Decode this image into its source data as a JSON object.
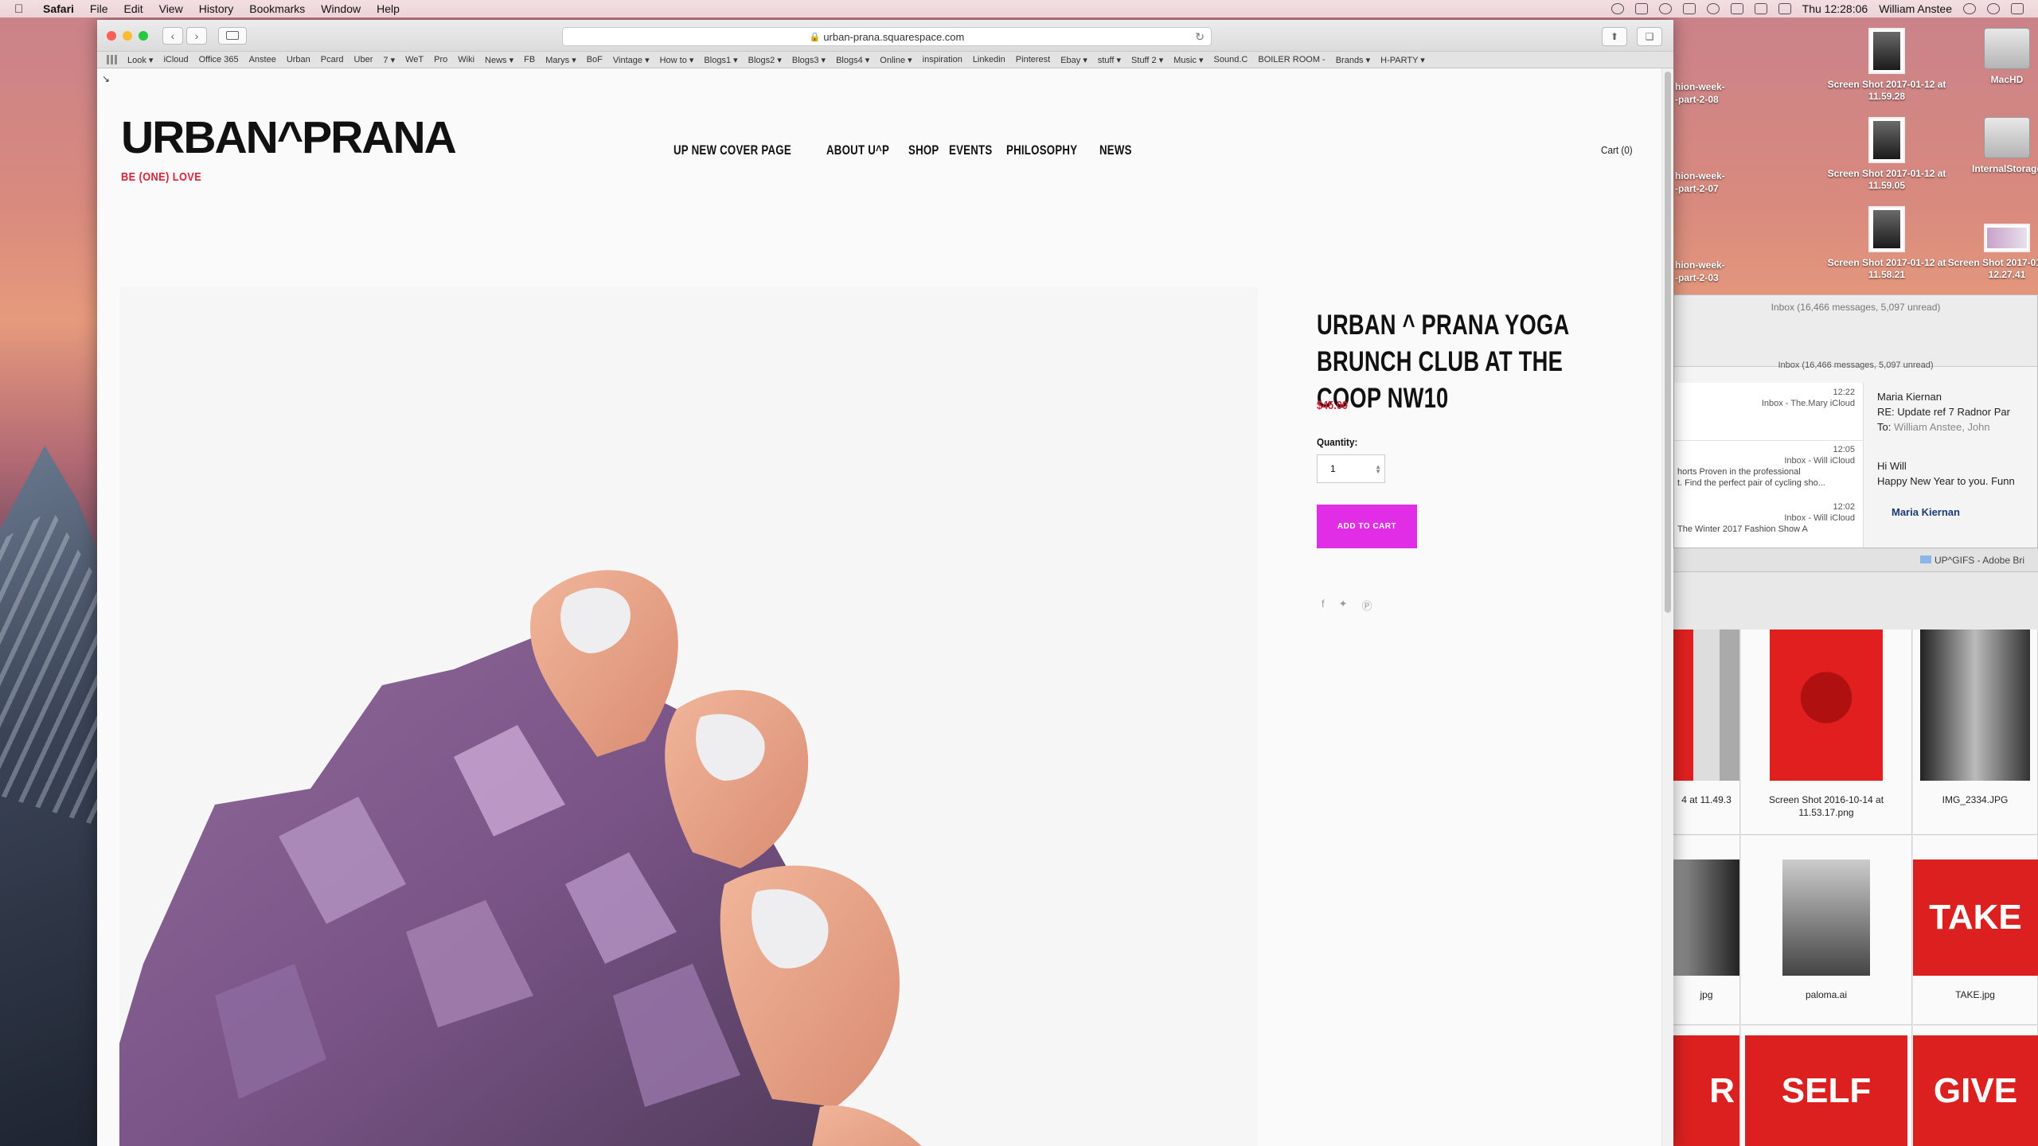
{
  "menubar": {
    "app_name": "Safari",
    "items": [
      "File",
      "Edit",
      "View",
      "History",
      "Bookmarks",
      "Window",
      "Help"
    ],
    "clock": "Thu 12:28:06",
    "user": "William Anstee"
  },
  "browser": {
    "url": "urban-prana.squarespace.com",
    "bookmarks": [
      "Look ▾",
      "iCloud",
      "Office 365",
      "Anstee",
      "Urban",
      "Pcard",
      "Uber",
      "7 ▾",
      "WeT",
      "Pro",
      "Wiki",
      "News ▾",
      "FB",
      "Marys ▾",
      "BoF",
      "Vintage ▾",
      "How to ▾",
      "Blogs1 ▾",
      "Blogs2 ▾",
      "Blogs3 ▾",
      "Blogs4 ▾",
      "Online ▾",
      "inspiration",
      "Linkedin",
      "Pinterest",
      "Ebay ▾",
      "stuff ▾",
      "Stuff 2 ▾",
      "Music ▾",
      "Sound.C",
      "BOILER ROOM -",
      "Brands ▾",
      "H-PARTY ▾"
    ]
  },
  "site": {
    "logo": "URBAN^PRANA",
    "tagline": "BE (ONE) LOVE",
    "nav": [
      "UP NEW COVER PAGE",
      "ABOUT U^P",
      "SHOP",
      "EVENTS",
      "PHILOSOPHY",
      "NEWS"
    ],
    "cart": "Cart (0)"
  },
  "product": {
    "title": "URBAN ^ PRANA YOGA BRUNCH CLUB AT THE COOP NW10",
    "price": "$45.00",
    "quantity_label": "Quantity:",
    "quantity_value": "1",
    "add_to_cart": "ADD TO CART",
    "accent": "#e12ee6",
    "price_color": "#e0213a"
  },
  "desktop": {
    "icons": [
      {
        "label": "Screen Shot 2017-01-12 at 11.59.28"
      },
      {
        "label": "MacHD"
      },
      {
        "label": "Screen Shot 2017-01-12 at 11.59.05"
      },
      {
        "label": "InternalStorage"
      },
      {
        "label": "Screen Shot 2017-01-12 at 11.58.21"
      },
      {
        "label": "Screen Shot 2017-01-12 at 12.27.41"
      }
    ],
    "partial_labels": [
      "hion-week-",
      "-part-2-08",
      "hion-week-",
      "-part-2-07",
      "hion-week-",
      "-part-2-03"
    ]
  },
  "mail": {
    "inbox_count": "Inbox (16,466 messages, 5,097 unread)",
    "messages": [
      {
        "time": "12:22",
        "meta": "Inbox - The.Mary iCloud",
        "snippet": ""
      },
      {
        "time": "12:05",
        "meta": "Inbox - Will iCloud",
        "snippet": "horts Proven in the professional",
        "snippet2": "t. Find the perfect pair of cycling sho..."
      },
      {
        "time": "12:02",
        "meta": "Inbox - Will iCloud",
        "snippet": "The Winter 2017 Fashion Show A"
      }
    ],
    "reader": {
      "from": "Maria Kiernan",
      "subject": "RE: Update ref 7 Radnor Par",
      "to_label": "To:",
      "to": "William Anstee,    John",
      "greeting": "Hi Will",
      "body": "Happy New Year to you.  Funn",
      "signature": "Maria Kiernan"
    }
  },
  "bridge": {
    "title": "UP^GIFS - Adobe Bri",
    "tiles": [
      {
        "label": "4 at 11.49.3"
      },
      {
        "label": "Screen Shot 2016-10-14 at 11.53.17.png"
      },
      {
        "label": "IMG_2334.JPG"
      },
      {
        "label": "jpg"
      },
      {
        "label": "paloma.ai"
      },
      {
        "label": "TAKE.jpg"
      }
    ],
    "tile_words": [
      "TAKE",
      "R",
      "SELF",
      "GIVE"
    ]
  }
}
